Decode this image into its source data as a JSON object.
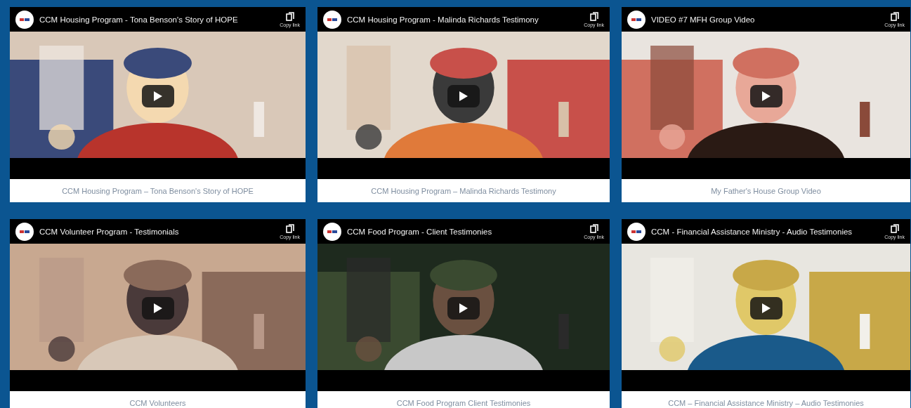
{
  "videos": [
    {
      "title": "CCM Housing Program - Tona Benson's Story of HOPE",
      "copy_label": "Copy link",
      "caption": "CCM Housing Program – Tona Benson's Story of HOPE"
    },
    {
      "title": "CCM Housing Program - Malinda Richards Testimony",
      "copy_label": "Copy link",
      "caption": "CCM Housing Program – Malinda Richards Testimony"
    },
    {
      "title": "VIDEO #7 MFH Group Video",
      "copy_label": "Copy link",
      "caption": "My Father's House Group Video"
    },
    {
      "title": "CCM Volunteer Program - Testimonials",
      "copy_label": "Copy link",
      "caption": "CCM Volunteers"
    },
    {
      "title": "CCM Food Program - Client Testimonies",
      "copy_label": "Copy link",
      "caption": "CCM Food Program Client Testimonies"
    },
    {
      "title": "CCM - Financial Assistance Ministry - Audio Testimonies",
      "copy_label": "Copy link",
      "caption": "CCM – Financial Assistance Ministry – Audio Testimonies"
    }
  ]
}
